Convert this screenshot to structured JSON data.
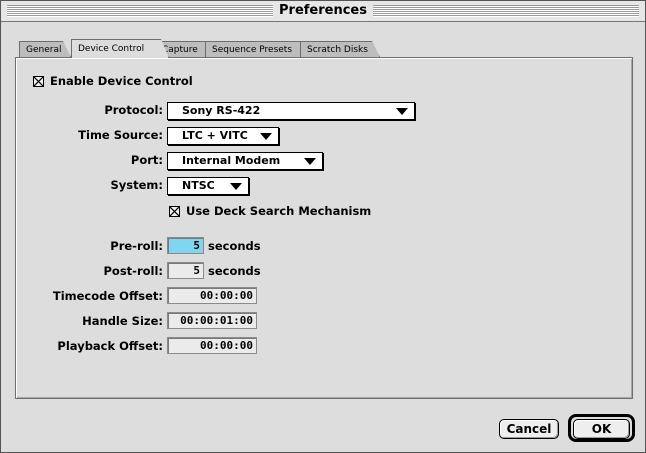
{
  "window": {
    "title": "Preferences"
  },
  "tabs": [
    {
      "label": "General",
      "active": false
    },
    {
      "label": "Device Control",
      "active": true
    },
    {
      "label": "Capture",
      "active": false
    },
    {
      "label": "Sequence Presets",
      "active": false
    },
    {
      "label": "Scratch Disks",
      "active": false
    }
  ],
  "enable_device_control": {
    "label": "Enable Device Control",
    "checked": true
  },
  "protocol": {
    "label": "Protocol:",
    "value": "Sony RS-422"
  },
  "time_source": {
    "label": "Time Source:",
    "value": "LTC + VITC"
  },
  "port": {
    "label": "Port:",
    "value": "Internal Modem"
  },
  "system": {
    "label": "System:",
    "value": "NTSC"
  },
  "deck_search": {
    "label": "Use Deck Search Mechanism",
    "checked": true
  },
  "pre_roll": {
    "label": "Pre-roll:",
    "value": "5",
    "unit": "seconds"
  },
  "post_roll": {
    "label": "Post-roll:",
    "value": "5",
    "unit": "seconds"
  },
  "timecode_offset": {
    "label": "Timecode Offset:",
    "value": "00:00:00"
  },
  "handle_size": {
    "label": "Handle Size:",
    "value": "00:00:01:00"
  },
  "playback_offset": {
    "label": "Playback Offset:",
    "value": "00:00:00"
  },
  "buttons": {
    "cancel": "Cancel",
    "ok": "OK"
  },
  "colors": {
    "focus_field": "#7fd6ee",
    "window_bg": "#dddddd"
  }
}
